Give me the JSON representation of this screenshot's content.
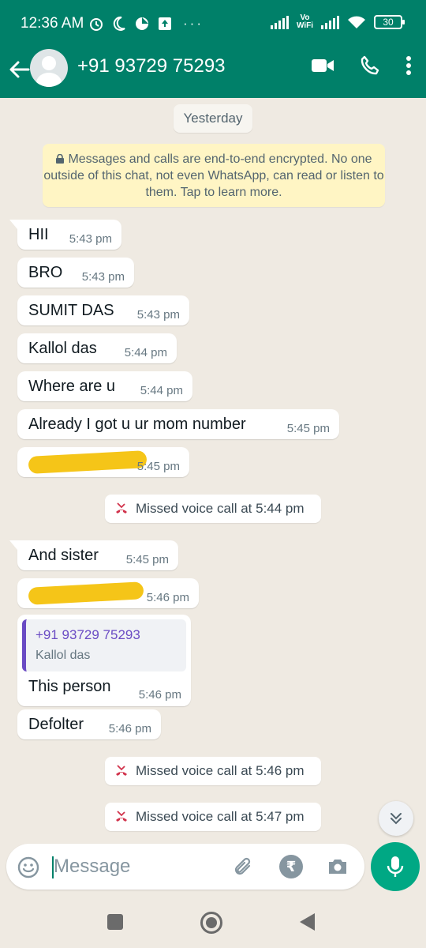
{
  "status_bar": {
    "time": "12:36 AM",
    "network_label": "Vo\nWiFi",
    "battery": "30"
  },
  "header": {
    "contact_name": "+91 93729 75293",
    "icons": [
      "back-arrow-icon",
      "avatar",
      "video-call-icon",
      "voice-call-icon",
      "more-options-icon"
    ]
  },
  "chat": {
    "date_chip": "Yesterday",
    "encryption_notice": "Messages and calls are end-to-end encrypted. No one outside of this chat, not even WhatsApp, can read or listen to them. Tap to learn more.",
    "messages": [
      {
        "text": "HII",
        "time": "5:43 pm"
      },
      {
        "text": "BRO",
        "time": "5:43 pm"
      },
      {
        "text": "SUMIT DAS",
        "time": "5:43 pm"
      },
      {
        "text": "Kallol das",
        "time": "5:44 pm"
      },
      {
        "text": "Where are u",
        "time": "5:44 pm"
      },
      {
        "text": "Already I got u ur mom number",
        "time": "5:45 pm"
      },
      {
        "text": "",
        "time": "5:45 pm",
        "redacted": true
      },
      {
        "text": "And sister",
        "time": "5:45 pm"
      },
      {
        "text": "",
        "time": "5:46 pm",
        "redacted": true
      },
      {
        "text": "This person",
        "time": "5:46 pm",
        "quoted_contact": {
          "number": "+91 93729 75293",
          "name": "Kallol das"
        }
      },
      {
        "text": "Defolter",
        "time": "5:46 pm"
      }
    ],
    "missed_calls": [
      "Missed voice call at 5:44 pm",
      "Missed voice call at 5:46 pm",
      "Missed voice call at 5:47 pm"
    ],
    "colors": {
      "header": "#008069",
      "wallpaper": "#efeae2",
      "bubble": "#ffffff",
      "missed_call": "#d1334c",
      "quote_accent": "#6a4bc4",
      "send": "#00a884",
      "redaction": "#f5c518"
    }
  },
  "composer": {
    "placeholder": "Message",
    "rupee_symbol": "₹"
  }
}
